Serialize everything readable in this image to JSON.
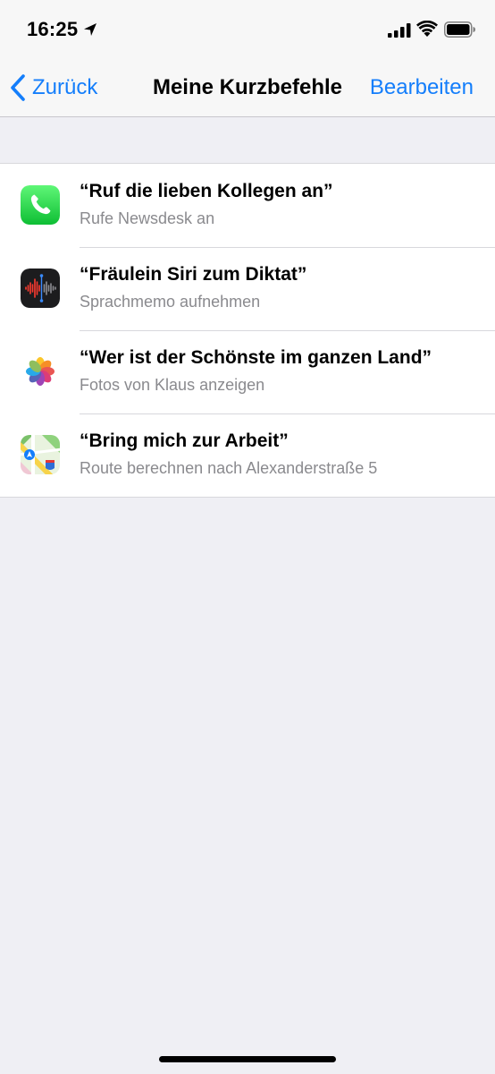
{
  "status_bar": {
    "time": "16:25",
    "icons": [
      "location-arrow-icon",
      "cellular-signal-icon",
      "wifi-icon",
      "battery-icon"
    ]
  },
  "nav": {
    "back_label": "Zurück",
    "title": "Meine Kurzbefehle",
    "edit_label": "Bearbeiten"
  },
  "colors": {
    "accent": "#147efb",
    "background": "#efeff4",
    "secondary_text": "#8a8a8e"
  },
  "shortcuts": [
    {
      "title": "“Ruf die lieben Kollegen an”",
      "subtitle": "Rufe Newsdesk an",
      "icon": "phone-app-icon"
    },
    {
      "title": "“Fräulein Siri zum Diktat”",
      "subtitle": "Sprachmemo aufnehmen",
      "icon": "voice-memos-app-icon"
    },
    {
      "title": "“Wer ist der Schönste im ganzen Land”",
      "subtitle": "Fotos von Klaus anzeigen",
      "icon": "photos-app-icon"
    },
    {
      "title": "“Bring mich zur Arbeit”",
      "subtitle": "Route berechnen nach Alexanderstraße 5",
      "icon": "maps-app-icon"
    }
  ]
}
